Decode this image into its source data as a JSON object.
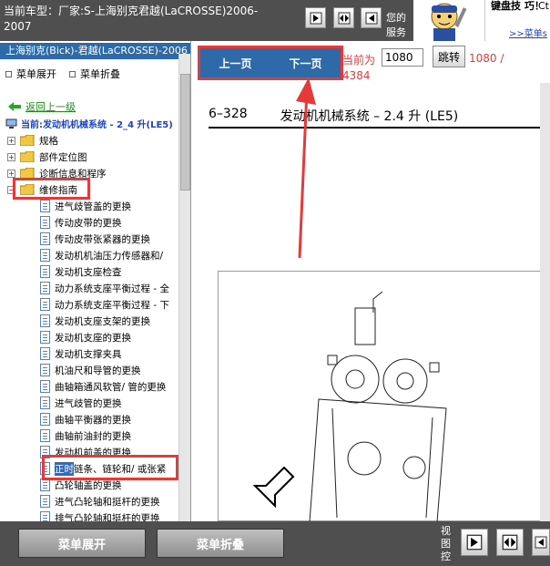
{
  "header": {
    "car_title": "当前车型：厂家:S-上海别克君越(LaCROSSE)2006-2007",
    "service_text": "您的服务",
    "ad_text": "键盘技 巧！",
    "ad_corner": "Ct",
    "ad_link": ">>菜单s"
  },
  "tree": {
    "header": "上海别克(Bick)-君越(LaCROSSE)-2006",
    "menu_expand": "菜单展开",
    "menu_collapse": "菜单折叠",
    "back": "返回上一级",
    "current": "当前:发动机机械系统 - 2_4 升(LE5)",
    "folders": [
      {
        "label": "规格",
        "exp": "+"
      },
      {
        "label": "部件定位图",
        "exp": "+"
      },
      {
        "label": "诊断信息和程序",
        "exp": "+"
      },
      {
        "label": "维修指南",
        "exp": "−"
      }
    ],
    "items": [
      "进气歧管盖的更换",
      "传动皮带的更换",
      "传动皮带张紧器的更换",
      "发动机机油压力传感器和/",
      "发动机支座检查",
      "动力系统支座平衡过程 - 全",
      "动力系统支座平衡过程 - 下",
      "发动机支座支架的更换",
      "发动机支座的更换",
      "发动机支撑夹具",
      "机油尺和导管的更换",
      "曲轴箱通风软管/ 管的更换",
      "进气歧管的更换",
      "曲轴平衡器的更换",
      "曲轴前油封的更换",
      "发动机前盖的更换"
    ],
    "selected_highlight": "正时",
    "selected_rest": "链条、链轮和/ 或张紧",
    "after_items": [
      "凸轮轴盖的更换",
      "进气凸轮轴和挺杆的更换",
      "排气凸轮轴和挺杆的更换"
    ]
  },
  "pager": {
    "prev": "上一页",
    "next": "下一页",
    "current_label": "当前为",
    "current_value": "1080",
    "goto": "跳转",
    "count": "1080 /",
    "total": "4384"
  },
  "document": {
    "page_code": "6–328",
    "title": "发动机机械系统 – 2.4 升 (LE5)"
  },
  "footer": {
    "expand": "菜单展开",
    "collapse": "菜单折叠",
    "view_control": "视图控"
  },
  "colors": {
    "accent_blue": "#2f6aa8",
    "annotation_red": "#e53a3a",
    "bar_gray": "#4f4f4f"
  }
}
